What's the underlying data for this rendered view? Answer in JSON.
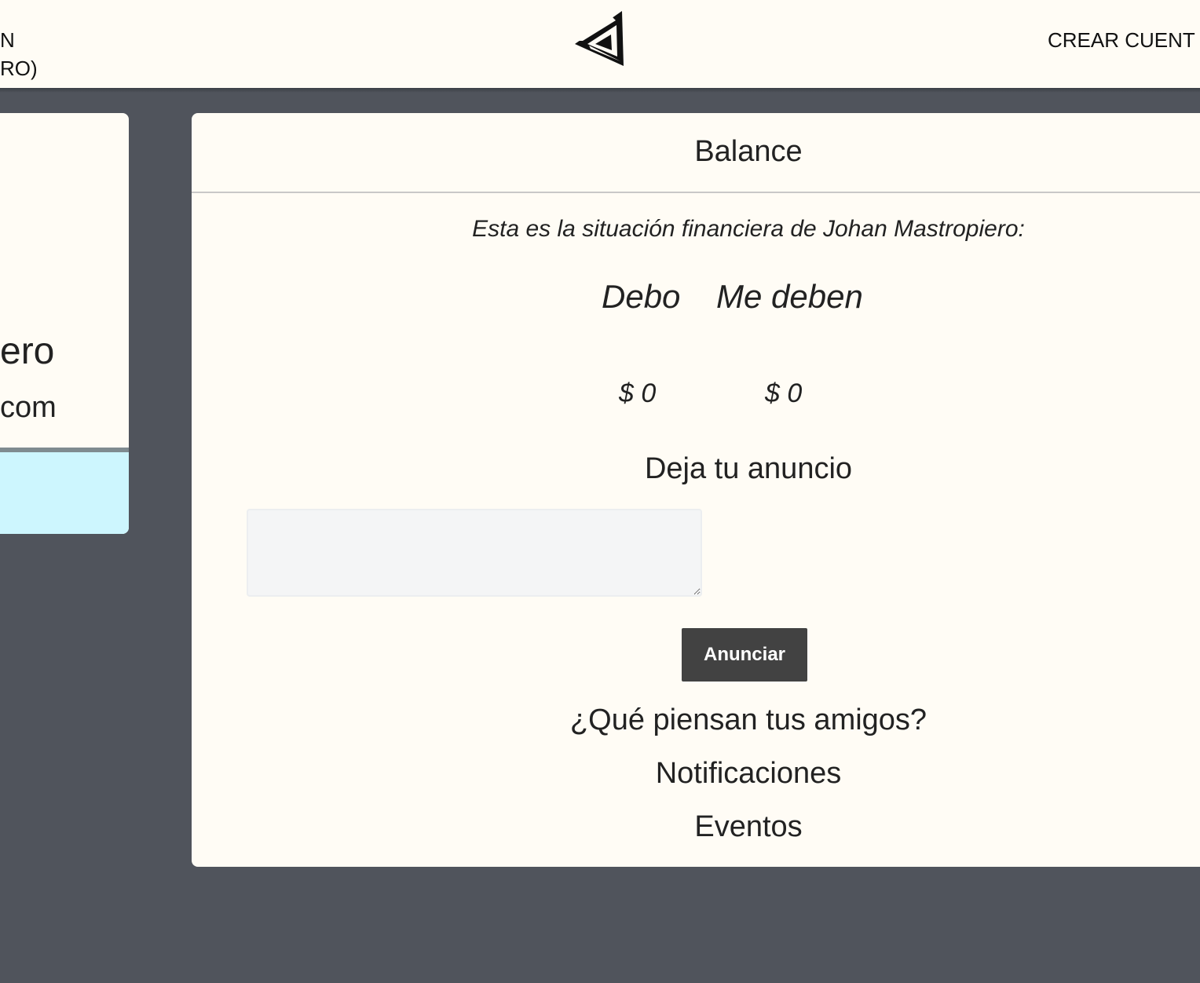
{
  "navbar": {
    "left_line1": "N",
    "left_line2": "RO)",
    "right_link": "CREAR CUENT",
    "logo_icon": "impossible-triangle-logo"
  },
  "profile": {
    "name": "ero",
    "email": "com",
    "footer_color": "#cdf6fe"
  },
  "balance": {
    "title": "Balance",
    "intro": "Esta es la situación financiera de Johan Mastropiero:",
    "owe_label": "Debo",
    "owed_label": "Me deben",
    "owe_value": "$ 0",
    "owed_value": "$ 0"
  },
  "announcement": {
    "title": "Deja tu anuncio",
    "input_value": "",
    "button_label": "Anunciar"
  },
  "sections": {
    "friends": "¿Qué piensan tus amigos?",
    "notifications": "Notificaciones",
    "events": "Eventos"
  },
  "colors": {
    "page_bg": "#50545c",
    "card_bg": "#fffcf5",
    "button_bg": "#424242"
  }
}
